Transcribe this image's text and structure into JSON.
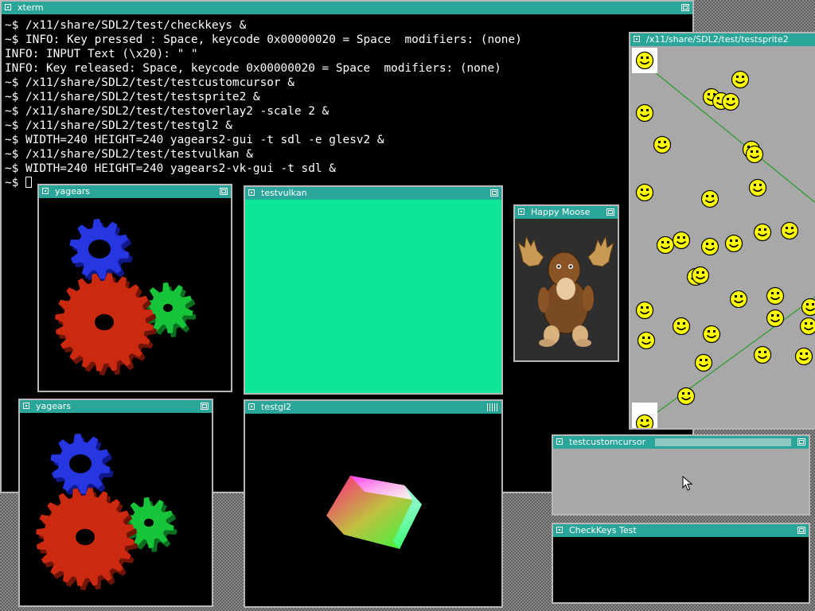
{
  "xterm": {
    "title": "xterm",
    "lines": [
      "~$ /x11/share/SDL2/test/checkkeys &",
      "~$ INFO: Key pressed : Space, keycode 0x00000020 = Space  modifiers: (none)",
      "INFO: INPUT Text (\\x20): \" \"",
      "INFO: Key released: Space, keycode 0x00000020 = Space  modifiers: (none)",
      "~$ /x11/share/SDL2/test/testcustomcursor &",
      "~$ /x11/share/SDL2/test/testsprite2 &",
      "~$ /x11/share/SDL2/test/testoverlay2 -scale 2 &",
      "~$ /x11/share/SDL2/test/testgl2 &",
      "~$ WIDTH=240 HEIGHT=240 yagears2-gui -t sdl -e glesv2 &",
      "~$ /x11/share/SDL2/test/testvulkan &",
      "~$ WIDTH=240 HEIGHT=240 yagears2-vk-gui -t sdl &"
    ],
    "prompt": "~$ "
  },
  "windows": {
    "yagears_top": {
      "title": "yagears"
    },
    "testvulkan": {
      "title": "testvulkan",
      "fill_color": "#0de597"
    },
    "happy_moose": {
      "title": "Happy Moose"
    },
    "testsprite2": {
      "title": "/x11/share/SDL2/test/testsprite2"
    },
    "yagears_bottom": {
      "title": "yagears"
    },
    "testgl2": {
      "title": "testgl2"
    },
    "testcustomcursor": {
      "title": "testcustomcursor"
    },
    "checkkeys": {
      "title": "CheckKeys Test"
    }
  },
  "colors": {
    "titlebar": "#29a59a",
    "gear_red": "#cc2a10",
    "gear_blue": "#2636e0",
    "gear_green": "#18c43a",
    "sprite_bg": "#a8a8a8"
  }
}
